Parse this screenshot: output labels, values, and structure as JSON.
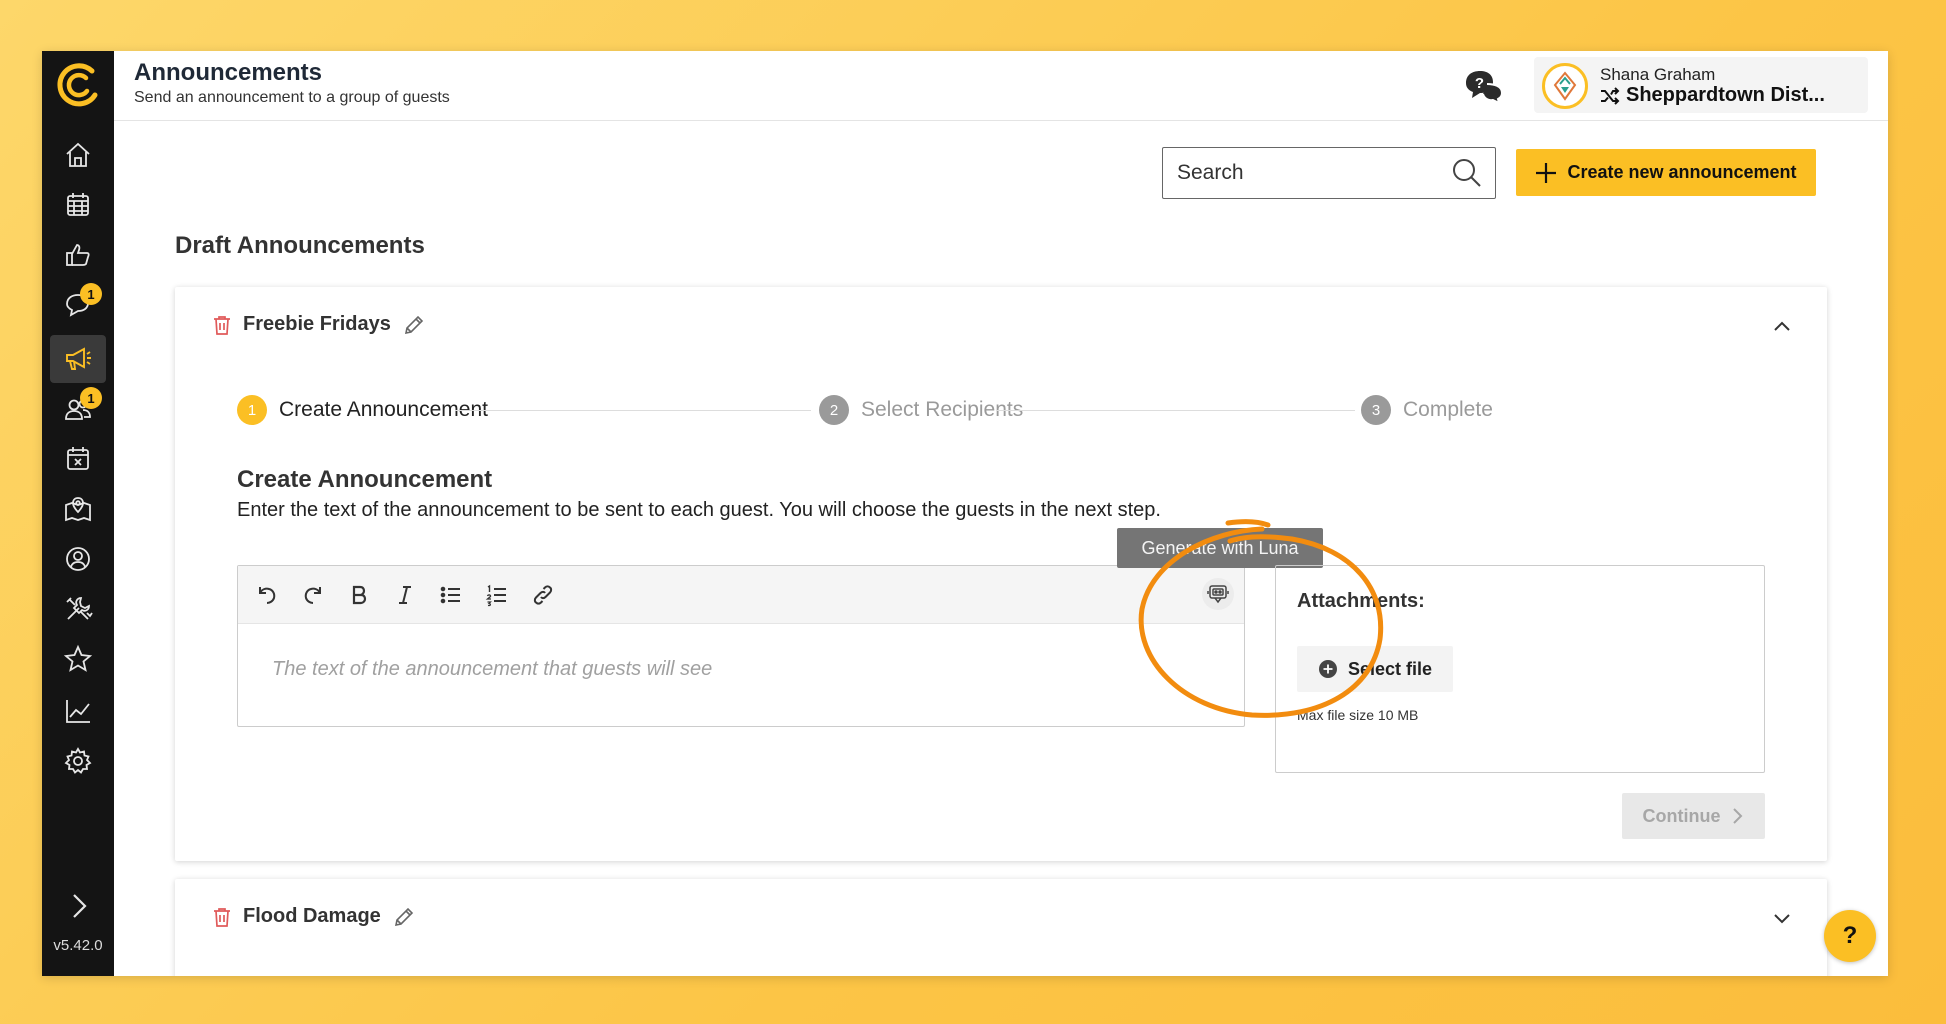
{
  "app": {
    "version": "v5.42.0"
  },
  "header": {
    "title": "Announcements",
    "subtitle": "Send an announcement to a group of guests",
    "user": {
      "name": "Shana Graham",
      "org": "Sheppardtown Dist..."
    }
  },
  "sidebar": {
    "items": [
      {
        "name": "home",
        "icon": "home-icon"
      },
      {
        "name": "calendar",
        "icon": "calendar-grid-icon"
      },
      {
        "name": "feedback",
        "icon": "thumbs-up-icon"
      },
      {
        "name": "messages",
        "icon": "chat-icon",
        "badge": "1"
      },
      {
        "name": "announcements",
        "icon": "megaphone-icon",
        "active": true
      },
      {
        "name": "guests",
        "icon": "users-icon",
        "badge": "1"
      },
      {
        "name": "events",
        "icon": "calendar-x-icon"
      },
      {
        "name": "map",
        "icon": "map-pin-icon"
      },
      {
        "name": "profile",
        "icon": "user-circle-icon"
      },
      {
        "name": "tools",
        "icon": "tools-icon"
      },
      {
        "name": "favorites",
        "icon": "star-icon"
      },
      {
        "name": "reports",
        "icon": "chart-line-icon"
      },
      {
        "name": "settings",
        "icon": "gear-icon"
      }
    ]
  },
  "toolbar": {
    "search_placeholder": "Search",
    "create_label": "Create new announcement"
  },
  "section": {
    "title": "Draft Announcements"
  },
  "cards": [
    {
      "title": "Freebie Fridays",
      "expanded": true,
      "steps": [
        {
          "num": "1",
          "label": "Create Announcement",
          "state": "active"
        },
        {
          "num": "2",
          "label": "Select Recipients",
          "state": "inactive"
        },
        {
          "num": "3",
          "label": "Complete",
          "state": "inactive"
        }
      ],
      "form": {
        "title": "Create Announcement",
        "description": "Enter the text of the announcement to be sent to each guest. You will choose the guests in the next step.",
        "editor_placeholder": "The text of the announcement that guests will see",
        "tooltip": "Generate with Luna"
      },
      "attachments": {
        "title": "Attachments:",
        "select_label": "Select file",
        "max_size": "Max file size 10 MB"
      },
      "continue_label": "Continue"
    },
    {
      "title": "Flood Damage",
      "expanded": false
    }
  ],
  "help": {
    "label": "?"
  },
  "colors": {
    "accent": "#fbbf24",
    "sidebar": "#141414",
    "annotation": "#f28c0f",
    "delete": "#e05a5a"
  }
}
